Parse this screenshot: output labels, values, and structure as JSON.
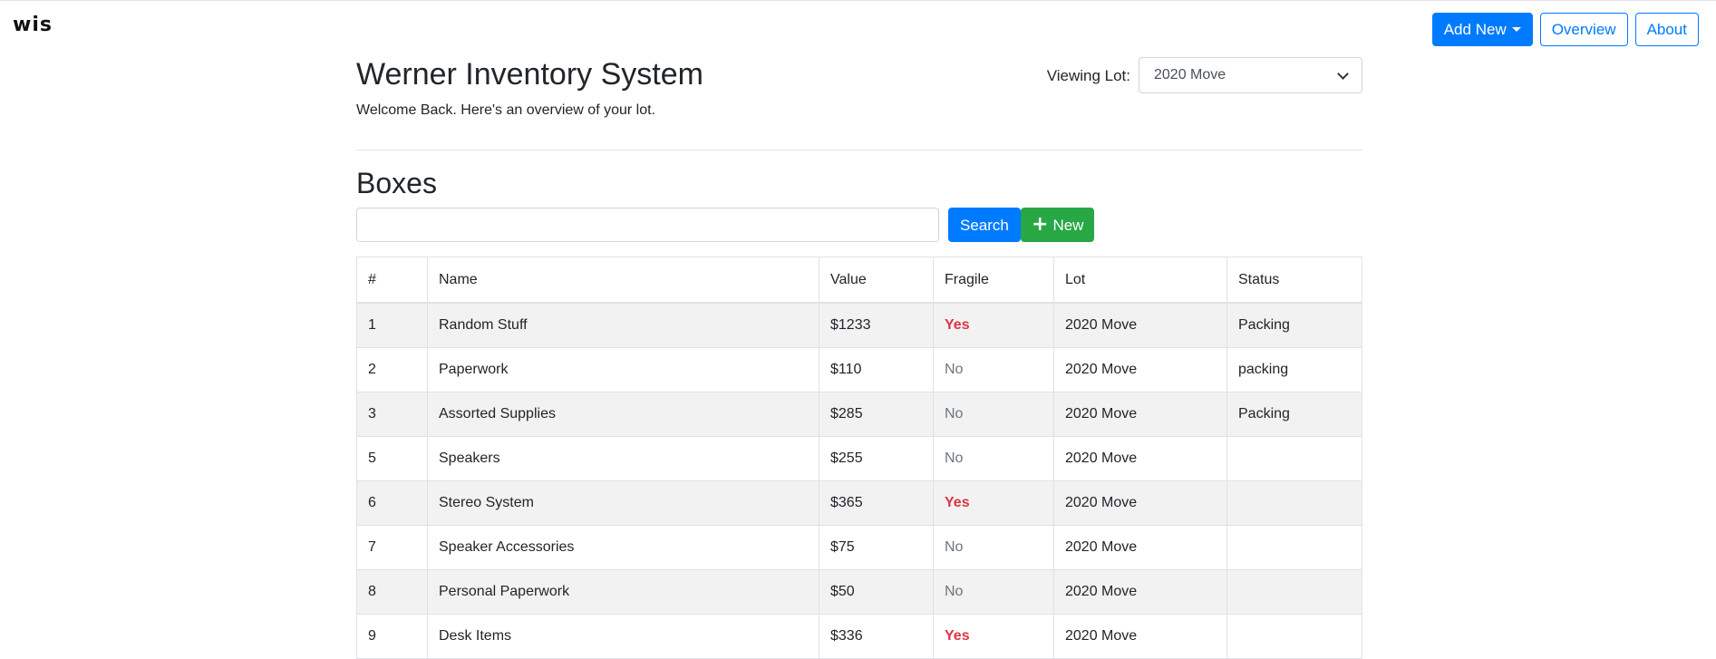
{
  "brand": "wis",
  "nav": {
    "add_new": "Add New",
    "overview": "Overview",
    "about": "About"
  },
  "header": {
    "title": "Werner Inventory System",
    "subtitle": "Welcome Back. Here's an overview of your lot.",
    "lot_label": "Viewing Lot:",
    "lot_selected": "2020 Move"
  },
  "boxes": {
    "title": "Boxes",
    "search_value": "",
    "search_label": "Search",
    "new_label": "New",
    "columns": [
      "#",
      "Name",
      "Value",
      "Fragile",
      "Lot",
      "Status"
    ],
    "rows": [
      {
        "num": "1",
        "name": "Random Stuff",
        "value": "$1233",
        "fragile": "Yes",
        "lot": "2020 Move",
        "status": "Packing"
      },
      {
        "num": "2",
        "name": "Paperwork",
        "value": "$110",
        "fragile": "No",
        "lot": "2020 Move",
        "status": "packing"
      },
      {
        "num": "3",
        "name": "Assorted Supplies",
        "value": "$285",
        "fragile": "No",
        "lot": "2020 Move",
        "status": "Packing"
      },
      {
        "num": "5",
        "name": "Speakers",
        "value": "$255",
        "fragile": "No",
        "lot": "2020 Move",
        "status": ""
      },
      {
        "num": "6",
        "name": "Stereo System",
        "value": "$365",
        "fragile": "Yes",
        "lot": "2020 Move",
        "status": ""
      },
      {
        "num": "7",
        "name": "Speaker Accessories",
        "value": "$75",
        "fragile": "No",
        "lot": "2020 Move",
        "status": ""
      },
      {
        "num": "8",
        "name": "Personal Paperwork",
        "value": "$50",
        "fragile": "No",
        "lot": "2020 Move",
        "status": ""
      },
      {
        "num": "9",
        "name": "Desk Items",
        "value": "$336",
        "fragile": "Yes",
        "lot": "2020 Move",
        "status": ""
      }
    ]
  },
  "colors": {
    "primary": "#007bff",
    "success": "#28a745",
    "danger": "#dc3545",
    "muted": "#6c757d"
  },
  "icons": {
    "add_new_caret": "caret-down-icon",
    "lot_select_chevron": "chevron-down-icon",
    "new_button": "plus-icon"
  }
}
